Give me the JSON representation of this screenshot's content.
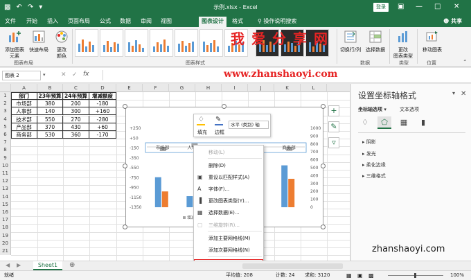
{
  "titlebar": {
    "title": "示例.xlsx  -  Excel",
    "login_label": "登录",
    "qat": [
      "save-icon",
      "undo-icon",
      "redo-icon"
    ]
  },
  "tabs": {
    "items": [
      "文件",
      "开始",
      "插入",
      "页面布局",
      "公式",
      "数据",
      "审阅",
      "视图",
      "图表设计",
      "格式"
    ],
    "active": "图表设计",
    "tell_me": "操作说明搜索",
    "share": "共享"
  },
  "ribbon": {
    "add_element_label": "添加图表\n元素",
    "quick_layout_label": "快速布局",
    "change_colors_label": "更改\n颜色",
    "switch_row_col_label": "切换行/列",
    "select_data_label": "选择数据",
    "change_type_label": "更改\n图表类型",
    "move_chart_label": "移动图表",
    "group_layouts": "图表布局",
    "group_styles": "图表样式",
    "group_data": "数据",
    "group_type": "类型",
    "group_location": "位置",
    "watermark": "我爱分享网",
    "watermark_url": "www.zhanshaoyi.com"
  },
  "formula_bar": {
    "name_box": "图表 2",
    "content": ""
  },
  "sheet": {
    "columns": [
      "A",
      "B",
      "C",
      "D",
      "E",
      "F",
      "G",
      "H",
      "I",
      "J",
      "K",
      "L"
    ],
    "rows": [
      "1",
      "2",
      "3",
      "4",
      "5",
      "6",
      "7",
      "8",
      "9",
      "10",
      "11",
      "12",
      "13",
      "14",
      "15",
      "16",
      "17",
      "18",
      "19",
      "20",
      "21"
    ],
    "table": {
      "headers": [
        "部门",
        "23年预算",
        "24年预算",
        "增减额度"
      ],
      "rows": [
        [
          "市场部",
          "380",
          "200",
          "-180"
        ],
        [
          "人事部",
          "140",
          "300",
          "+160"
        ],
        [
          "技术部",
          "550",
          "270",
          "-280"
        ],
        [
          "产品部",
          "370",
          "430",
          "+60"
        ],
        [
          "商务部",
          "530",
          "360",
          "-170"
        ]
      ]
    }
  },
  "chart_data": {
    "type": "bar",
    "categories": [
      "市场部",
      "人事部",
      "技术部",
      "产品部",
      "商务部"
    ],
    "series": [
      {
        "name": "23年预算",
        "values": [
          380,
          140,
          550,
          370,
          530
        ]
      },
      {
        "name": "24年预算",
        "values": [
          200,
          300,
          270,
          430,
          360
        ]
      },
      {
        "name": "增减额度",
        "values": [
          -180,
          160,
          -280,
          60,
          -170
        ]
      }
    ],
    "left_axis_ticks": [
      "+250",
      "+50",
      "-150",
      "-350",
      "-550",
      "-750",
      "-950",
      "-1150",
      "-1350"
    ],
    "right_axis_ticks": [
      "1000",
      "900",
      "800",
      "700",
      "600",
      "500",
      "400",
      "300",
      "200",
      "100",
      "0"
    ],
    "colors": {
      "s1": "#5b9bd5",
      "s2": "#ed7d31",
      "s3": "#a5a5a5"
    }
  },
  "mini_toolbar": {
    "fill_label": "填充",
    "outline_label": "边框",
    "selector_value": "水平 (类别) 轴"
  },
  "context_menu": {
    "items": [
      {
        "label": "移动(L)",
        "disabled": true,
        "icon": ""
      },
      {
        "label": "删除(D)",
        "disabled": false,
        "icon": ""
      },
      {
        "label": "重设以匹配样式(A)",
        "disabled": false,
        "icon": "reset-style-icon"
      },
      {
        "label": "字体(F)...",
        "disabled": false,
        "icon": "font-icon"
      },
      {
        "label": "更改图表类型(Y)...",
        "disabled": false,
        "icon": "chart-type-icon"
      },
      {
        "label": "选择数据(E)...",
        "disabled": false,
        "icon": "select-data-icon"
      },
      {
        "label": "三维旋转(R)...",
        "disabled": true,
        "icon": "rotate-3d-icon"
      },
      {
        "label": "添加主要网格线(M)",
        "disabled": false,
        "icon": ""
      },
      {
        "label": "添加次要网格线(N)",
        "disabled": false,
        "icon": ""
      },
      {
        "label": "设置坐标轴格式(F)...",
        "disabled": false,
        "icon": "format-axis-icon",
        "highlighted": true
      }
    ]
  },
  "pane": {
    "title": "设置坐标轴格式",
    "tab_axis_options": "坐标轴选项",
    "tab_text_options": "文本选项",
    "sections": [
      "阴影",
      "发光",
      "柔化边缘",
      "三维格式"
    ]
  },
  "sheet_tabs": {
    "active": "Sheet1"
  },
  "status": {
    "ready": "就绪",
    "average": "平均值: 208",
    "count": "计数: 24",
    "sum": "求和: 3120",
    "zoom": "100%",
    "watermark2": "zhanshaoyi.com"
  }
}
